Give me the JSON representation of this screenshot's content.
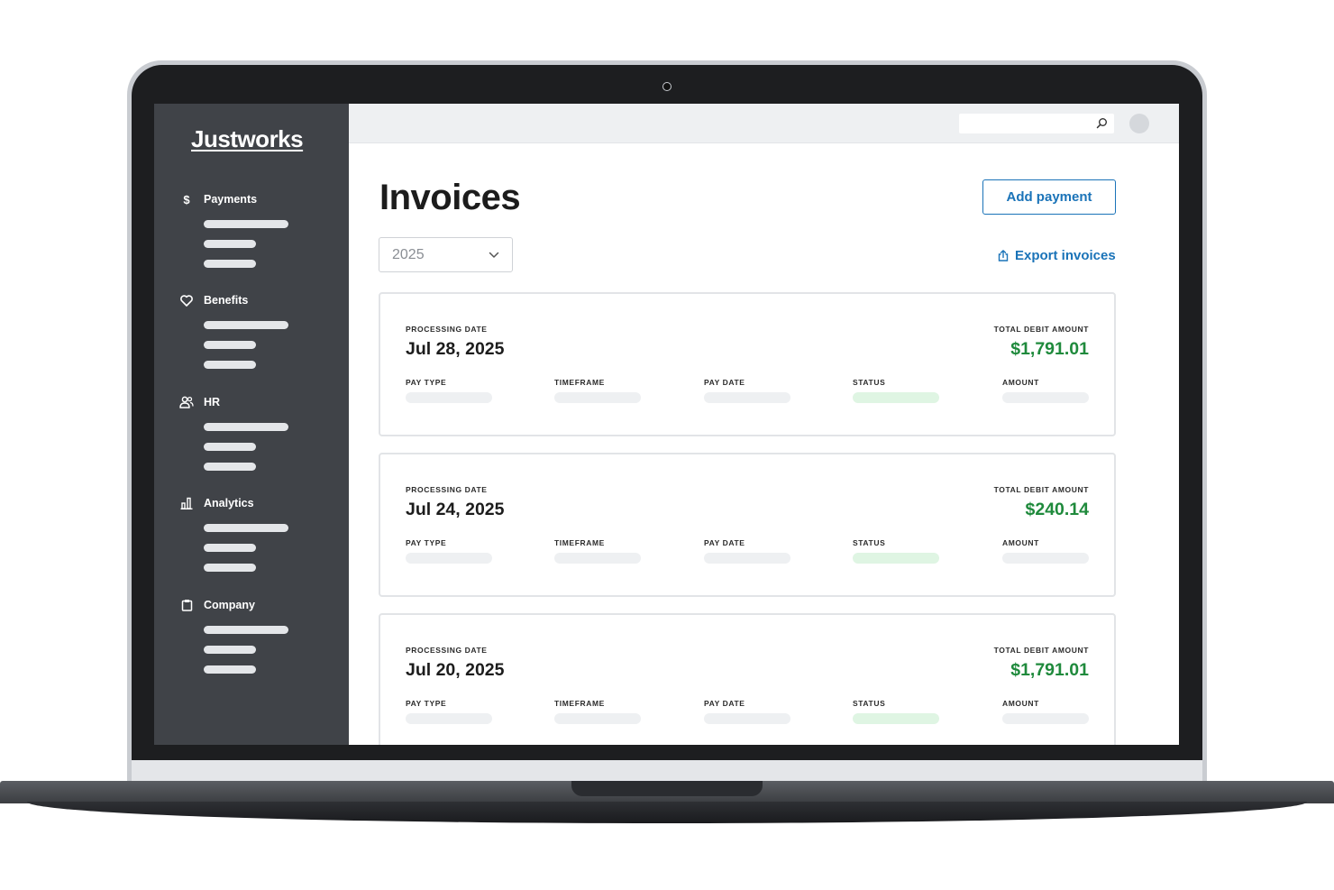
{
  "sidebar": {
    "logo": "Justworks",
    "items": [
      {
        "label": "Payments",
        "icon": "dollar-icon"
      },
      {
        "label": "Benefits",
        "icon": "heart-icon"
      },
      {
        "label": "HR",
        "icon": "people-icon"
      },
      {
        "label": "Analytics",
        "icon": "bar-chart-icon"
      },
      {
        "label": "Company",
        "icon": "clipboard-icon"
      }
    ]
  },
  "topbar": {
    "search_placeholder": "",
    "search_icon": "search-icon"
  },
  "main": {
    "title": "Invoices",
    "add_payment_label": "Add payment",
    "year_select": {
      "value": "2025"
    },
    "export_label": "Export invoices",
    "columns": {
      "processing_date": "PROCESSING DATE",
      "total_debit_amount": "TOTAL DEBIT AMOUNT",
      "pay_type": "PAY TYPE",
      "timeframe": "TIMEFRAME",
      "pay_date": "PAY DATE",
      "status": "STATUS",
      "amount": "AMOUNT"
    },
    "invoices": [
      {
        "processing_date": "Jul 28, 2025",
        "total_debit_amount": "$1,791.01"
      },
      {
        "processing_date": "Jul 24, 2025",
        "total_debit_amount": "$240.14"
      },
      {
        "processing_date": "Jul 20, 2025",
        "total_debit_amount": "$1,791.01"
      }
    ]
  },
  "colors": {
    "sidebar_bg": "#404348",
    "accent_blue": "#1a73b8",
    "amount_green": "#1f8a3c",
    "status_green": "#dff5e3"
  }
}
